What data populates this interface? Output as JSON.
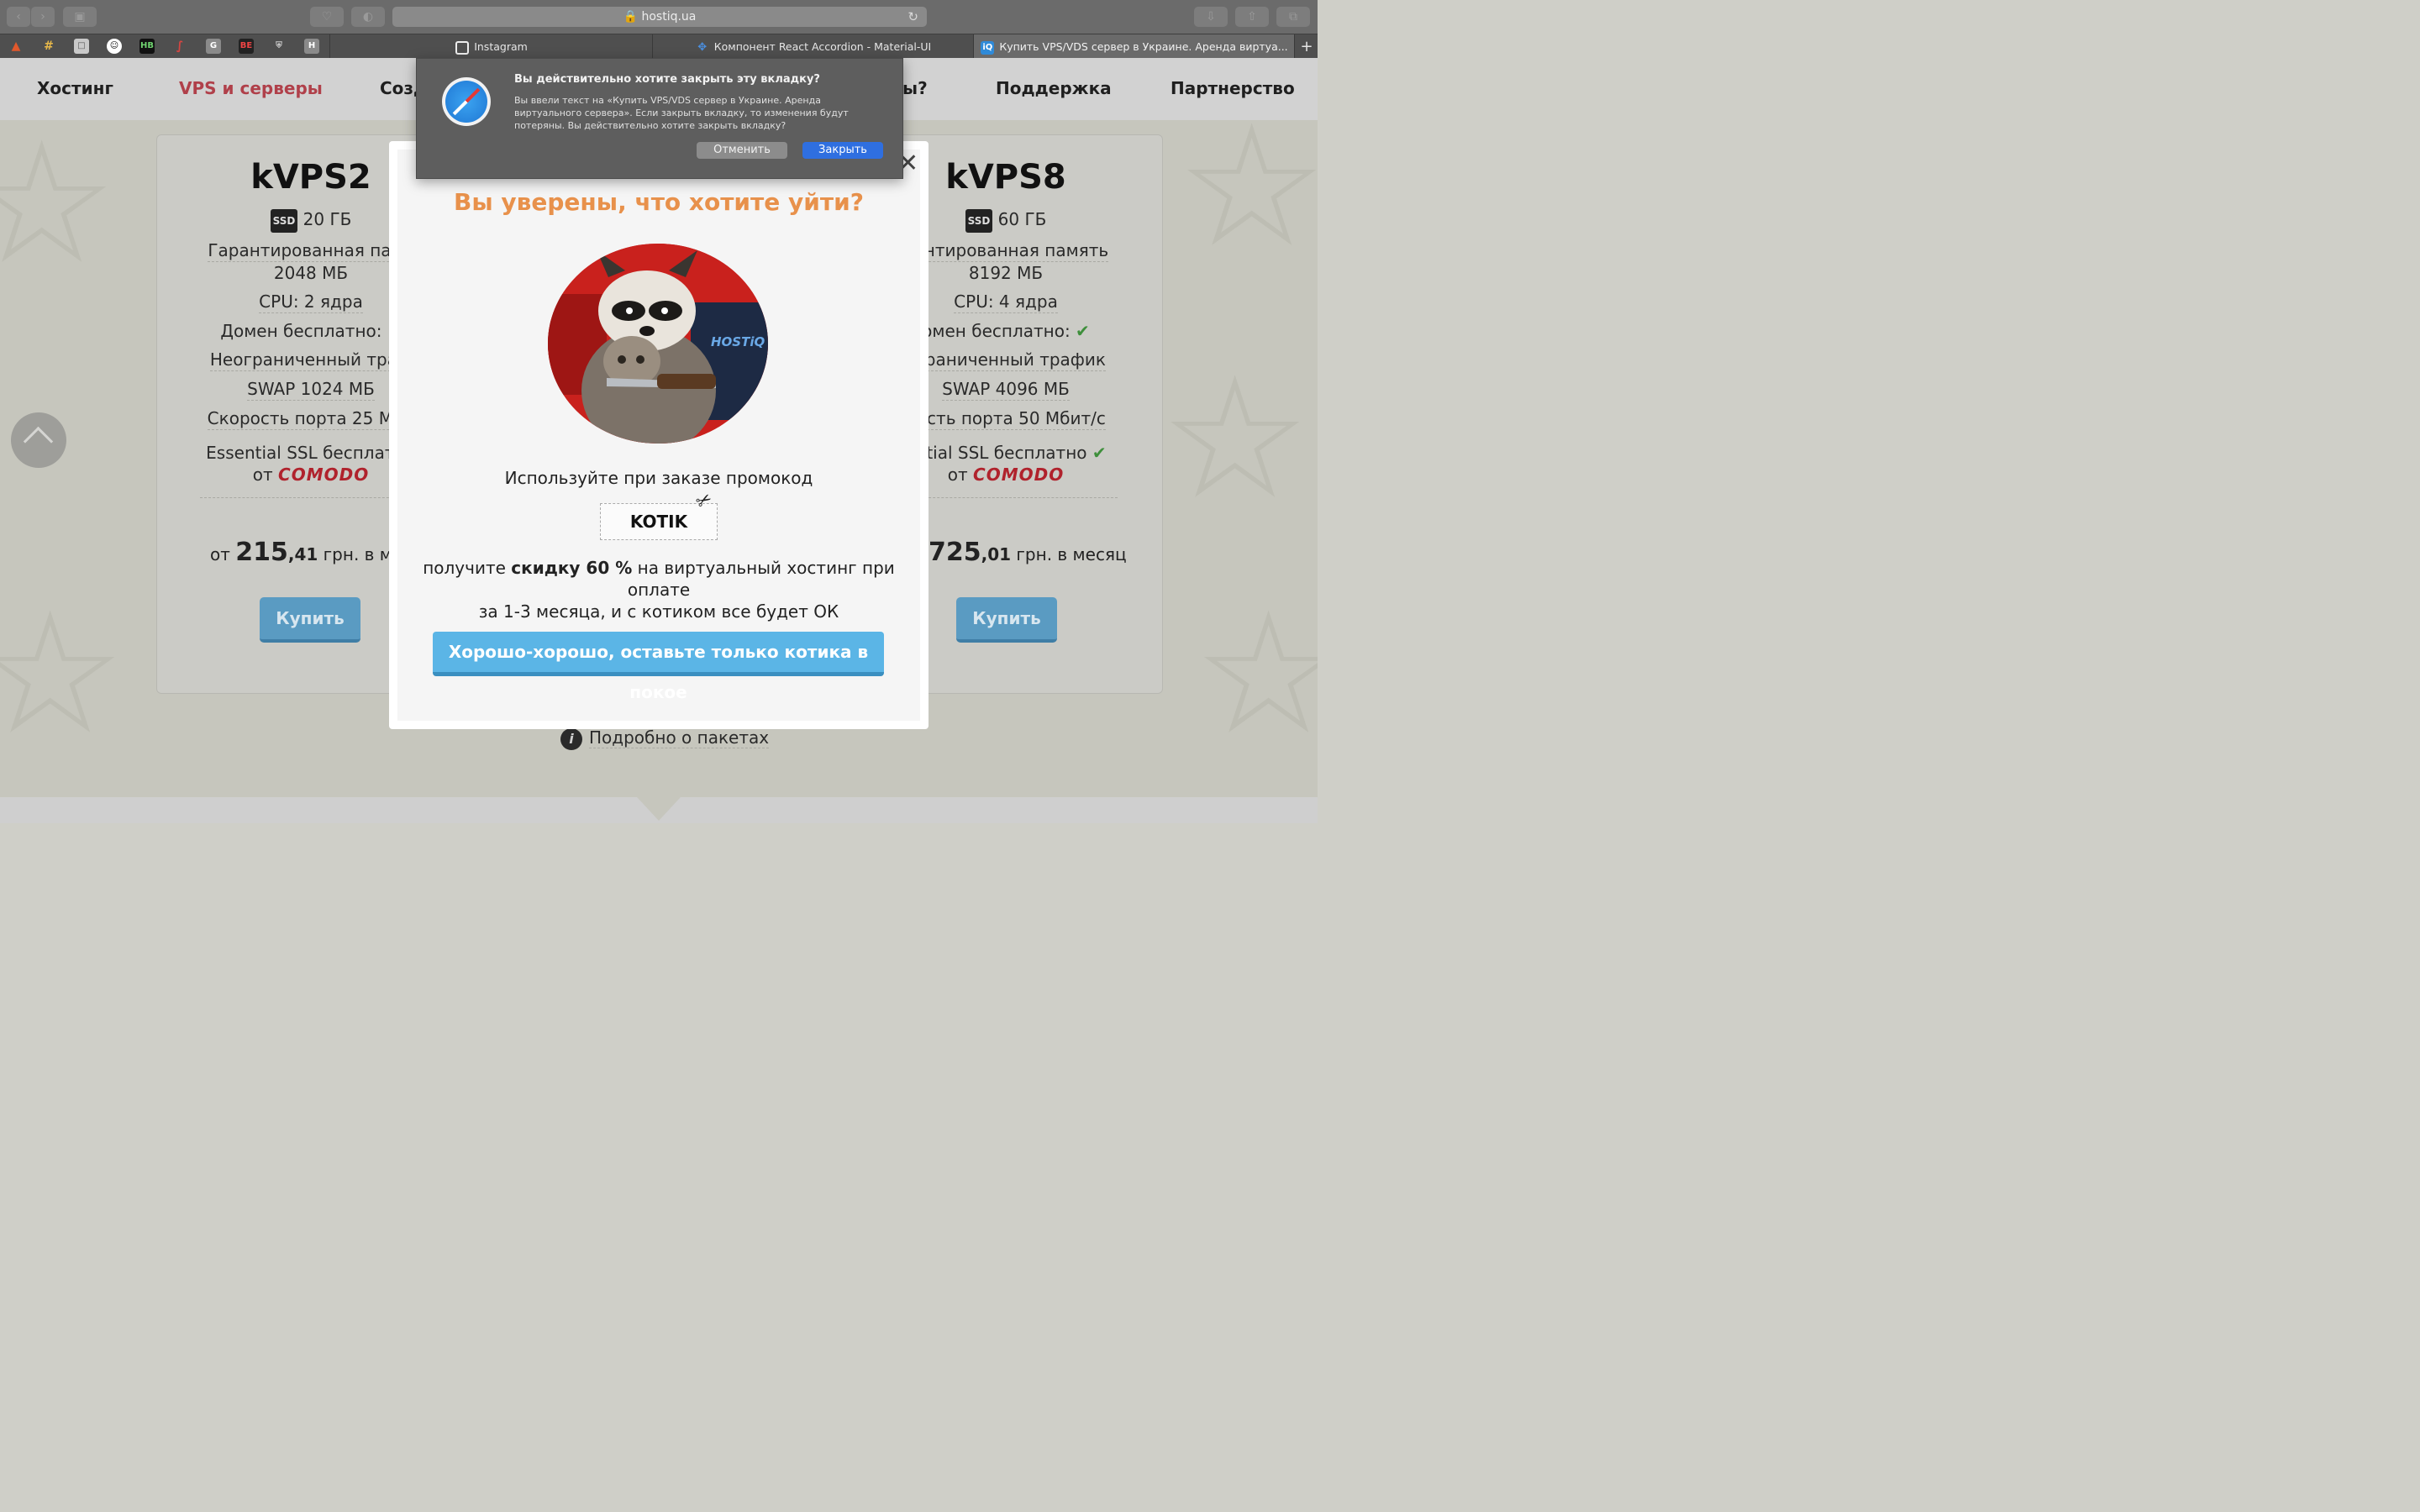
{
  "browser": {
    "url": "hostiq.ua",
    "tabs": [
      {
        "label": "Instagram"
      },
      {
        "label": "Компонент React Accordion - Material-UI"
      },
      {
        "label": "Купить VPS/VDS сервер в Украине. Аренда виртуа..."
      }
    ],
    "new_tab": "+",
    "favorites": [
      "gitlab",
      "slack",
      "docs",
      "github",
      "HB",
      "scribd",
      "G",
      "BE",
      "store",
      "H"
    ]
  },
  "site_nav": {
    "items": [
      "Хостинг",
      "VPS и серверы",
      "Созд",
      "ы?",
      "Поддержка",
      "Партнерство"
    ]
  },
  "plan_left": {
    "title": "kVPS2",
    "ssd_badge": "SSD",
    "ssd": "20 ГБ",
    "memory_label": "Гарантированная памя",
    "memory_value": "2048 МБ",
    "cpu": "CPU: 2 ядра",
    "domain": "Домен бесплатно:",
    "traffic": "Неограниченный траф",
    "swap": "SWAP 1024 МБ",
    "port": "Скорость порта 25 Мби",
    "ssl": "Essential SSL бесплатно",
    "ssl_from": "от",
    "comodo": "COMODO",
    "price_prefix": "от",
    "price_int": "215",
    "price_frac": ",41",
    "price_suffix": "грн. в мес",
    "buy": "Купить"
  },
  "plan_right": {
    "title": "kVPS8",
    "ssd_badge": "SSD",
    "ssd": "60 ГБ",
    "memory_label": "рантированная память",
    "memory_value": "8192 МБ",
    "cpu": "CPU: 4 ядра",
    "domain": "омен бесплатно:",
    "traffic": "ограниченный трафик",
    "swap": "SWAP 4096 МБ",
    "port": "рость порта 50 Мбит/с",
    "ssl": "ential SSL бесплатно",
    "ssl_from": "от",
    "comodo": "COMODO",
    "price_int": "725",
    "price_frac": ",01",
    "price_suffix": "грн. в месяц",
    "buy": "Купить"
  },
  "more_info": "Подробно о пакетах",
  "modal": {
    "title": "Вы уверены, что хотите уйти?",
    "promo_intro": "Используйте при заказе промокод",
    "promo_code": "KOTIK",
    "discount_pre": "получите",
    "discount_bold": "скидку 60 %",
    "discount_post": "на виртуальный хостинг при оплате",
    "discount_line2": "за 1-3 месяца, и с котиком все будет ОК",
    "button": "Хорошо-хорошо, оставьте только котика в покое",
    "close": "✕",
    "image_text": "HOSTiQ"
  },
  "alert": {
    "title": "Вы действительно хотите закрыть эту вкладку?",
    "message": "Вы ввели текст на «Купить VPS/VDS сервер в Украине. Аренда виртуального сервера». Если закрыть вкладку, то изменения будут потеряны. Вы действительно хотите закрыть вкладку?",
    "cancel": "Отменить",
    "confirm": "Закрыть"
  }
}
